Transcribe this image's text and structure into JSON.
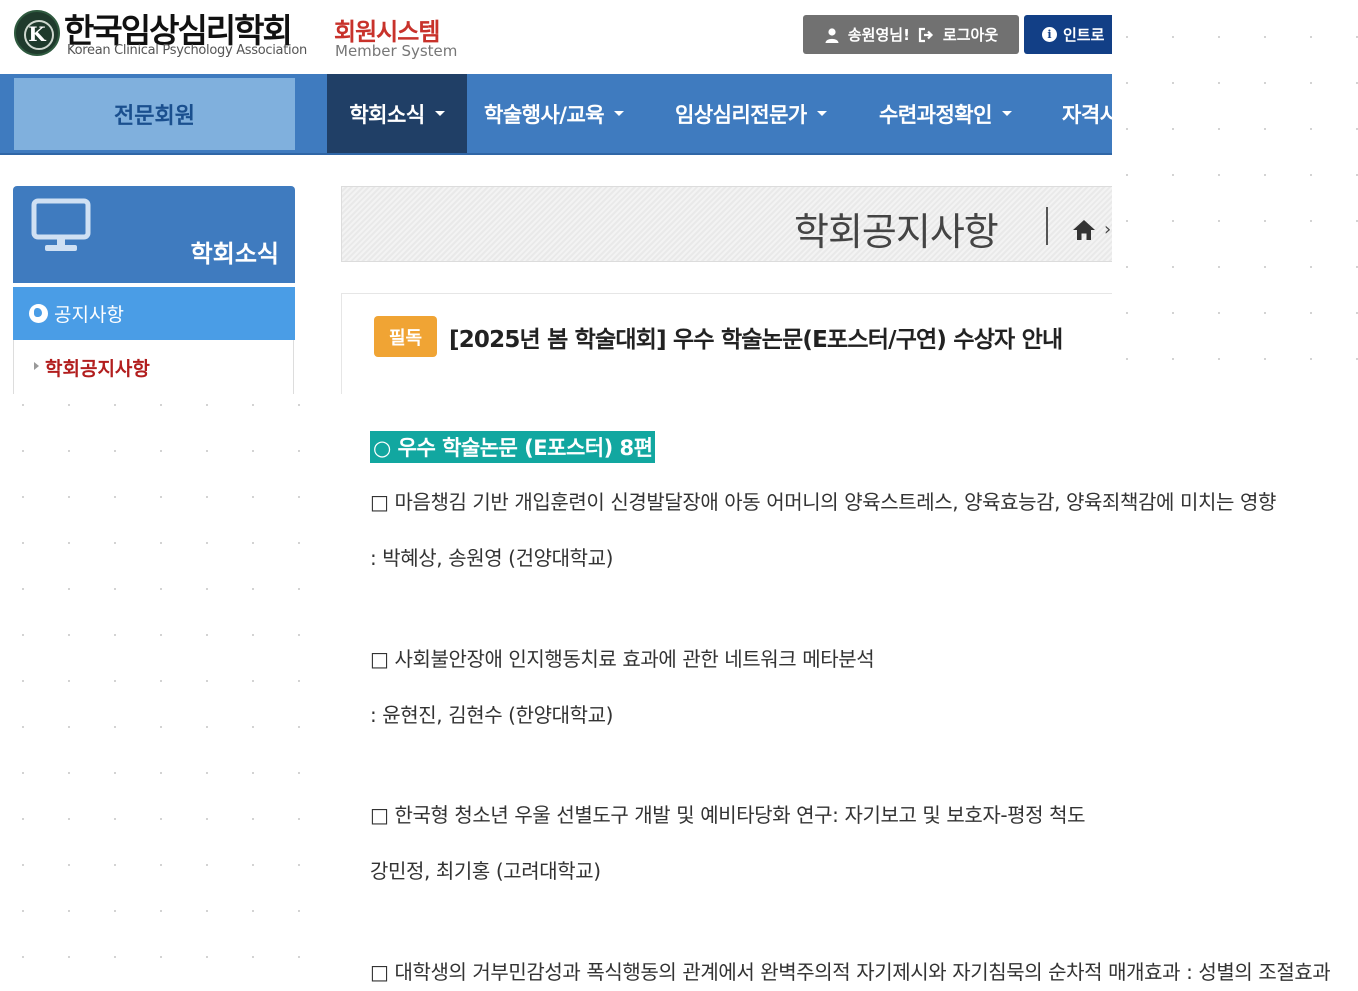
{
  "header": {
    "logo_mark": "K",
    "logo_title": "한국임상심리학회",
    "logo_en": "Korean Clinical Psychology Association",
    "system_title": "회원시스템",
    "system_en": "Member System",
    "user_greeting": "송원영님!",
    "logout_label": "로그아웃",
    "intro_label": "인트로"
  },
  "nav": {
    "member_label": "전문회원",
    "items": [
      {
        "label": "학회소식"
      },
      {
        "label": "학술행사/교육"
      },
      {
        "label": "임상심리전문가"
      },
      {
        "label": "수련과정확인"
      },
      {
        "label": "자격시"
      }
    ]
  },
  "sidebar": {
    "section_title": "학회소식",
    "active_item": "공지사항",
    "sub_item": "학회공지사항"
  },
  "page": {
    "title": "학회공지사항",
    "crumb_arrow": "›"
  },
  "post": {
    "badge": "필독",
    "title": "[2025년 봄 학술대회] 우수 학술논문(E포스터/구연) 수상자 안내",
    "section_heading": "○ 우수 학술논문 (E포스터) 8편",
    "lines": [
      "□ 마음챙김 기반 개입훈련이 신경발달장애 아동 어머니의 양육스트레스, 양육효능감, 양육죄책감에 미치는 영향",
      ": 박혜상, 송원영 (건양대학교)",
      "□ 사회불안장애 인지행동치료 효과에 관한 네트워크 메타분석",
      ": 윤현진, 김현수 (한양대학교)",
      "□ 한국형 청소년 우울 선별도구 개발 및 예비타당화 연구: 자기보고 및 보호자-평정 척도",
      "강민정, 최기홍 (고려대학교)",
      "□ 대학생의 거부민감성과 폭식행동의 관계에서 완벽주의적 자기제시와 자기침묵의 순차적 매개효과 : 성별의 조절효과"
    ]
  },
  "colors": {
    "nav_blue": "#3f7bbf",
    "nav_active": "#203f66",
    "member_tab": "#80b0dd",
    "sidebar_active": "#4a9de6",
    "badge_orange": "#f0a434",
    "heading_teal": "#12a7a0",
    "logout_gray": "#717171",
    "intro_navy": "#123f86",
    "sub_item_red": "#b21e1e",
    "brand_red": "#c8322b"
  },
  "icons": {
    "user": "user-icon",
    "logout": "logout-icon",
    "info": "info-icon",
    "monitor": "monitor-icon",
    "globe": "globe-icon",
    "home": "home-icon"
  }
}
